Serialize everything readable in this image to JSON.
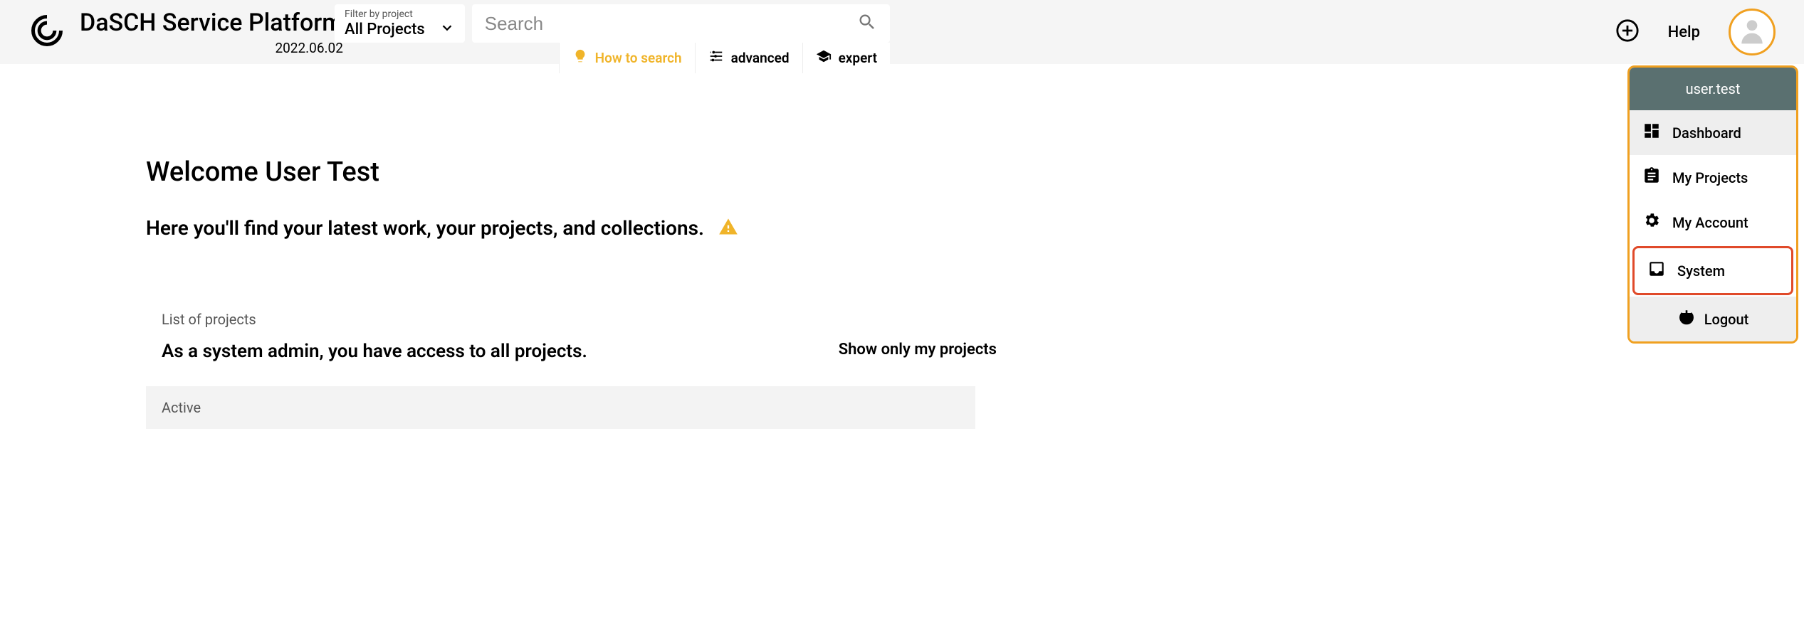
{
  "header": {
    "title": "DaSCH Service Platform",
    "version": "2022.06.02",
    "filter": {
      "label": "Filter by project",
      "value": "All Projects"
    },
    "search": {
      "placeholder": "Search"
    },
    "hints": {
      "how": "How to search",
      "advanced": "advanced",
      "expert": "expert"
    },
    "help": "Help"
  },
  "dropdown": {
    "user": "user.test",
    "items": [
      {
        "label": "Dashboard",
        "icon": "dashboard-icon",
        "active": true
      },
      {
        "label": "My Projects",
        "icon": "assignment-icon"
      },
      {
        "label": "My Account",
        "icon": "settings-icon"
      },
      {
        "label": "System",
        "icon": "inbox-icon",
        "highlight": true
      }
    ],
    "logout": "Logout"
  },
  "main": {
    "welcome": "Welcome User Test",
    "subtitle": "Here you'll find your latest work, your projects, and collections.",
    "list_label": "List of projects",
    "admin_note": "As a system admin, you have access to all projects.",
    "toggle": "Show only my projects",
    "active_label": "Active"
  }
}
